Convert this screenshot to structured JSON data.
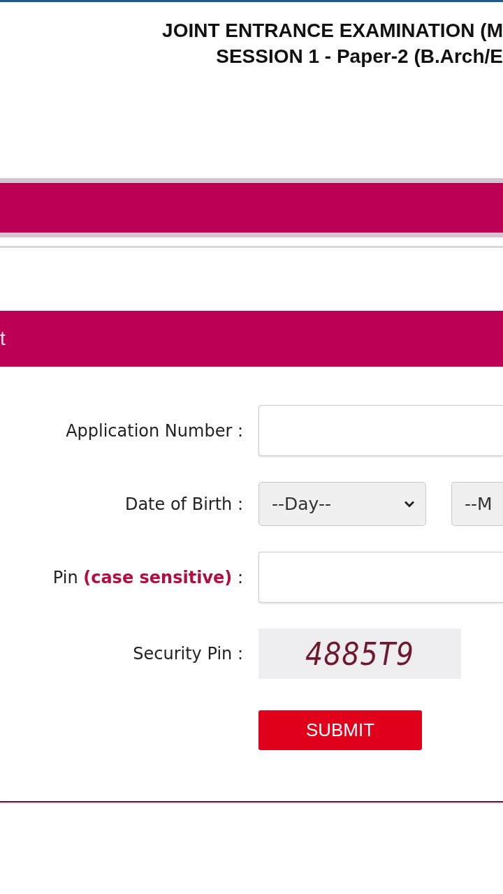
{
  "header": {
    "title_lines": [
      "JOINT ENTRANCE EXAMINATION (M",
      "SESSION 1 - Paper-2 (B.Arch/E"
    ]
  },
  "section_bar": {
    "title": "t"
  },
  "form": {
    "rows": [
      {
        "kind": "text",
        "label": "Application Number :"
      },
      {
        "kind": "selects",
        "label": "Date of Birth :",
        "selects": [
          {
            "value": "--Day--"
          },
          {
            "value": "--M"
          }
        ]
      },
      {
        "kind": "text",
        "label": "Pin **(case sensitive)** :"
      },
      {
        "kind": "captcha",
        "label": "Security Pin :",
        "code": "4885T9"
      },
      {
        "kind": "button",
        "label": "SUBMIT"
      }
    ]
  }
}
